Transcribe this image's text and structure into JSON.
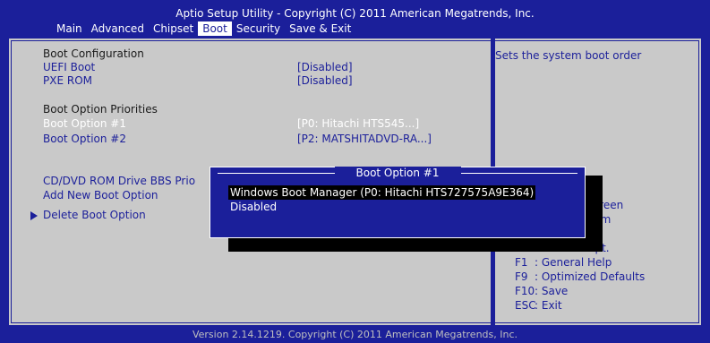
{
  "title": "Aptio Setup Utility - Copyright (C) 2011 American Megatrends, Inc.",
  "menu": [
    "Main",
    "Advanced",
    "Chipset",
    "Boot",
    "Security",
    "Save & Exit"
  ],
  "active_tab": "Boot",
  "section_boot_config": "Boot Configuration",
  "uefi_boot": {
    "label": "UEFI Boot",
    "value": "[Disabled]"
  },
  "pxe_rom": {
    "label": "PXE ROM",
    "value": "[Disabled]"
  },
  "section_priorities": "Boot Option Priorities",
  "boot_option_1": {
    "label": "Boot Option #1",
    "value": "[P0:  Hitachi HTS545...]"
  },
  "boot_option_2": {
    "label": "Boot Option #2",
    "value": "[P2: MATSHITADVD-RA...]"
  },
  "cd_dvd": "CD/DVD ROM Drive BBS Prio",
  "add_new": "Add New Boot Option",
  "delete_boot": "Delete Boot Option",
  "help": "Sets the system boot order",
  "keys_partial": [
    "Screen",
    "Item",
    "Opt."
  ],
  "keys": [
    {
      "key": "F1",
      "desc": ": General Help"
    },
    {
      "key": "F9",
      "desc": ": Optimized Defaults"
    },
    {
      "key": "F10",
      "desc": ": Save"
    },
    {
      "key": "ESC",
      "desc": ": Exit"
    }
  ],
  "popup": {
    "title": "Boot Option #1",
    "options": [
      "Windows Boot Manager (P0: Hitachi HTS727575A9E364)",
      "Disabled"
    ]
  },
  "footer": "Version 2.14.1219. Copyright (C) 2011 American Megatrends, Inc.",
  "colors": {
    "bios_blue": "#1b1f9a",
    "panel_gray": "#c9c9c9",
    "highlight": "#ffffff"
  }
}
